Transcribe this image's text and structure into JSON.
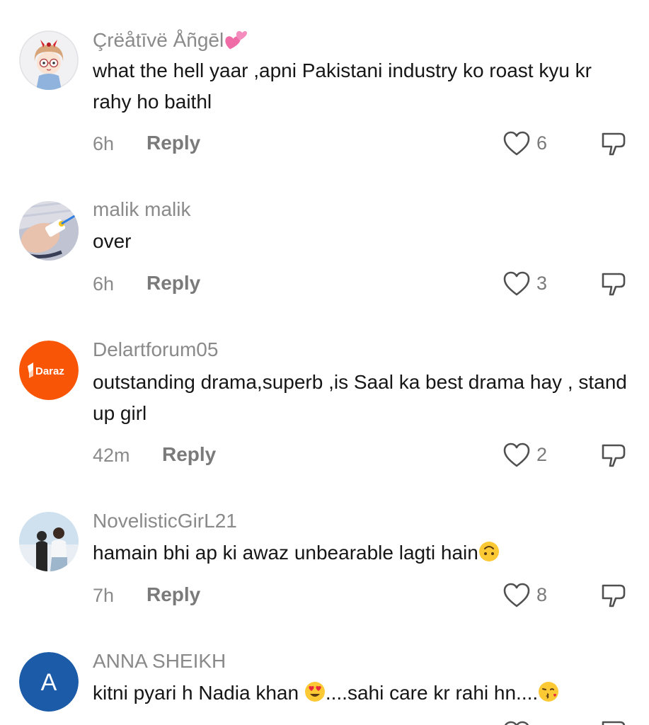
{
  "comments": [
    {
      "username": "Çrëåtīvë Åñgēl",
      "username_emoji": "two-hearts",
      "text": "what the hell yaar ,apni Pakistani industry ko roast kyu kr rahy ho baithl",
      "time": "6h",
      "reply_label": "Reply",
      "likes": "6",
      "avatar": "cartoon-girl-with-glasses"
    },
    {
      "username": "malik malik",
      "text": "over",
      "time": "6h",
      "reply_label": "Reply",
      "likes": "3",
      "avatar": "hand-photo"
    },
    {
      "username": "Delartforum05",
      "text": "outstanding drama,superb ,is Saal ka best drama hay , stand up girl",
      "time": "42m",
      "reply_label": "Reply",
      "likes": "2",
      "avatar": "daraz-logo",
      "avatar_text": "Daraz"
    },
    {
      "username": "NovelisticGirL21",
      "text": "hamain bhi ap ki awaz unbearable lagti hain",
      "text_emoji": "upside-down-face",
      "time": "7h",
      "reply_label": "Reply",
      "likes": "8",
      "avatar": "couple-photo"
    },
    {
      "username": "ANNA SHEIKH",
      "text_part1": "kitni pyari h Nadia khan ",
      "text_part2": "....sahi care kr rahi hn....",
      "text_emojis": [
        "heart-eyes-face",
        "kissing-face"
      ],
      "avatar": "letter-avatar",
      "avatar_letter": "A"
    }
  ],
  "colors": {
    "muted": "#8a8a8a",
    "text": "#161616",
    "daraz": "#f85606",
    "letter_avatar": "#1c5ba8"
  }
}
